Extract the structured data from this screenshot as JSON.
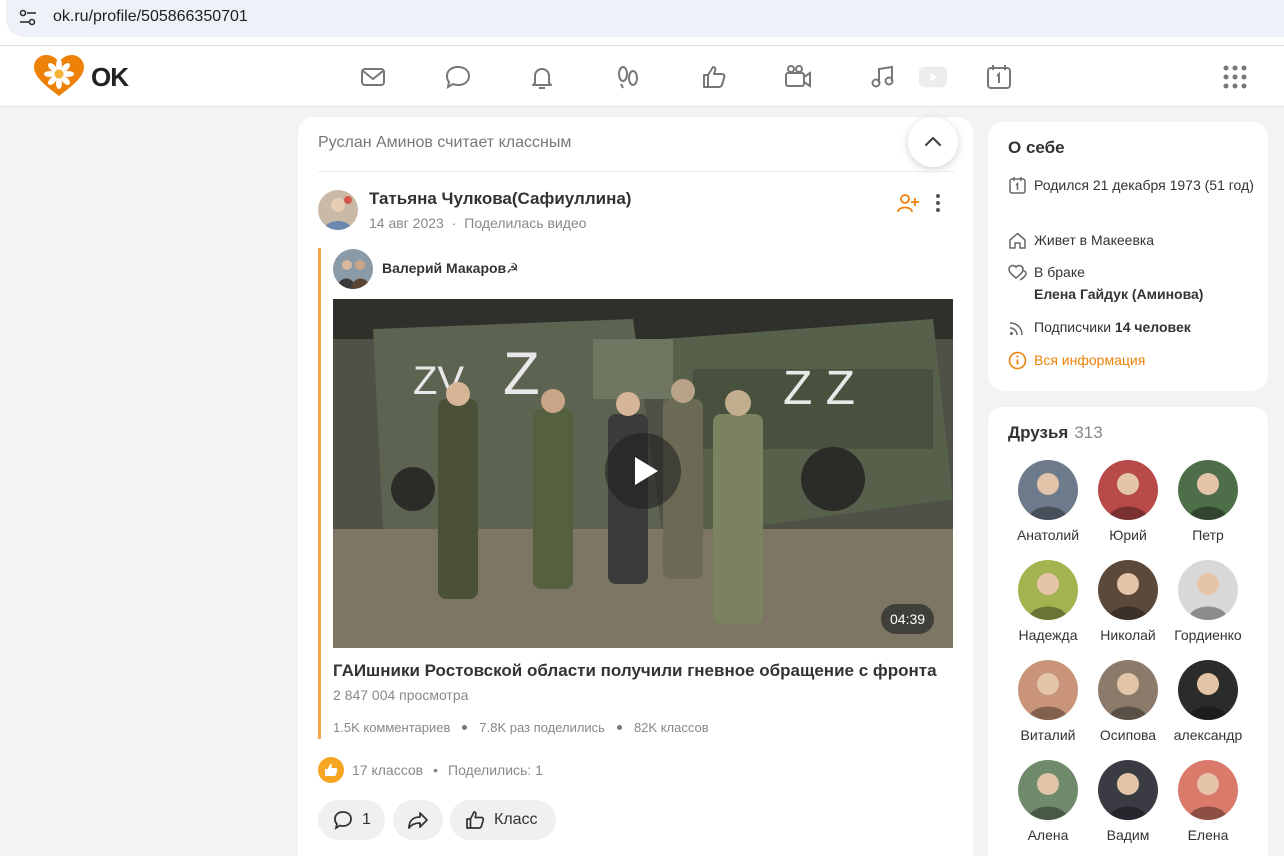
{
  "browser": {
    "url": "ok.ru/profile/505866350701"
  },
  "brand": {
    "logo_text": "OK",
    "accent": "#ee8208"
  },
  "nav": {
    "icons": [
      "messages-icon",
      "discussions-icon",
      "notifications-icon",
      "guests-icon",
      "events-icon",
      "video-icon",
      "music-icon",
      "live-icon",
      "calendar-icon",
      "apps-grid-icon"
    ]
  },
  "feed": {
    "header": "Руслан Аминов считает классным",
    "author": "Татьяна Чулкова(Сафиуллина)",
    "date": "14 авг 2023",
    "action": "Поделилась видео",
    "meta_sep": "·",
    "repost": {
      "author": "Валерий Макаров☭",
      "video": {
        "duration": "04:39",
        "title": "ГАИшники Ростовской области получили гневное обращение с фронта",
        "views": "2 847 004 просмотра",
        "stats": [
          "1.5K комментариев",
          "7.8K раз поделились",
          "82K классов"
        ]
      }
    },
    "likes": "17 классов",
    "likes_sep": "•",
    "shares": "Поделились: 1",
    "actions": {
      "comments": "1",
      "class_label": "Класс"
    }
  },
  "about": {
    "title": "О себе",
    "born": "Родился 21 декабря 1973 (51 год)",
    "lives": "Живет в Макеевка",
    "relationship": "В браке",
    "partner": "Елена Гайдук (Аминова)",
    "followers_label": "Подписчики",
    "followers_value": "14 человек",
    "more_info": "Вся информация"
  },
  "friends": {
    "title": "Друзья",
    "count": "313",
    "items": [
      {
        "name": "Анатолий",
        "color": "#6d7b8c"
      },
      {
        "name": "Юрий",
        "color": "#b84a4a"
      },
      {
        "name": "Петр",
        "color": "#4e6e49"
      },
      {
        "name": "Надежда",
        "color": "#a3b350"
      },
      {
        "name": "Николай",
        "color": "#5b4a3c"
      },
      {
        "name": "Гордиенко",
        "color": "#d8d8d8"
      },
      {
        "name": "Виталий",
        "color": "#c99479"
      },
      {
        "name": "Осипова",
        "color": "#8c7b6a"
      },
      {
        "name": "александр",
        "color": "#2b2b2b"
      },
      {
        "name": "Алена",
        "color": "#6e8a6a"
      },
      {
        "name": "Вадим",
        "color": "#3b3b44"
      },
      {
        "name": "Елена",
        "color": "#d97a6b"
      }
    ]
  }
}
